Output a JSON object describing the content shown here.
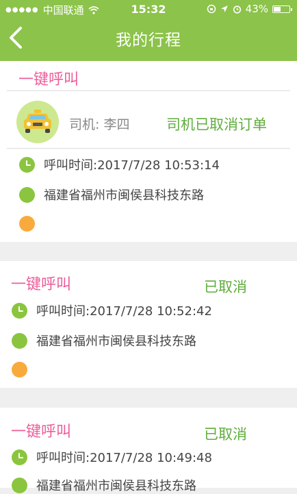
{
  "status_bar": {
    "carrier": "中国联通",
    "time": "15:32",
    "battery_percent": "43%",
    "battery_level": 0.43
  },
  "header": {
    "title": "我的行程",
    "back_icon": "chevron-left-icon"
  },
  "colors": {
    "header_green": "#8cc34a",
    "call_pink": "#ed5d9a",
    "status_green": "#5fad3c",
    "dot_green": "#8bc53f",
    "dot_orange": "#f8ab3c"
  },
  "trips": [
    {
      "label": "一键呼叫",
      "driver": "司机: 李四",
      "status": "司机已取消订单",
      "call_time": "呼叫时间:2017/7/28 10:53:14",
      "origin": "福建省福州市闽侯县科技东路"
    },
    {
      "label": "一键呼叫",
      "status": "已取消",
      "call_time": "呼叫时间:2017/7/28 10:52:42",
      "origin": "福建省福州市闽侯县科技东路"
    },
    {
      "label": "一键呼叫",
      "status": "已取消",
      "call_time": "呼叫时间:2017/7/28 10:49:48",
      "origin": "福建省福州市闽侯县科技东路"
    }
  ]
}
